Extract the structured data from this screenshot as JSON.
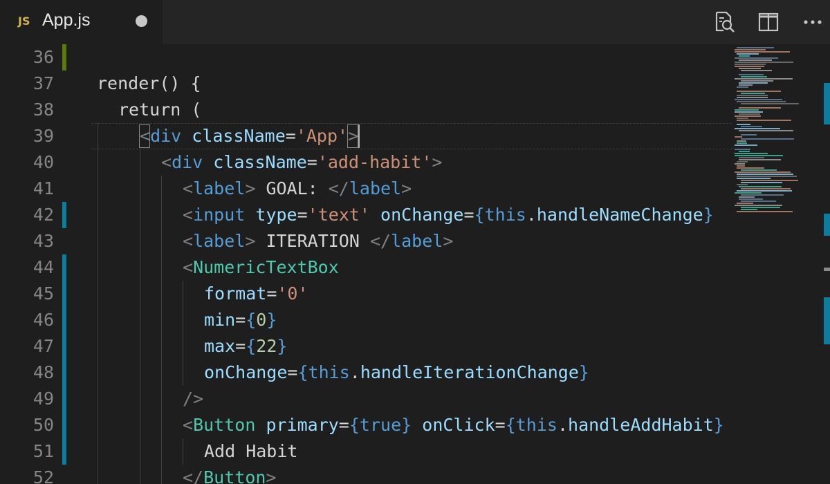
{
  "tab": {
    "lang_badge": "JS",
    "title": "App.js",
    "dirty": true
  },
  "actions": [
    {
      "name": "open-changes-icon"
    },
    {
      "name": "split-editor-icon"
    },
    {
      "name": "more-actions-icon"
    }
  ],
  "lines": [
    {
      "num": "36",
      "indent": 0,
      "gutter": "added",
      "tokens": []
    },
    {
      "num": "37",
      "indent": 0,
      "tokens": [
        {
          "t": "render",
          "c": "t-text"
        },
        {
          "t": "() {",
          "c": "t-text"
        }
      ]
    },
    {
      "num": "38",
      "indent": 1,
      "tokens": [
        {
          "t": "return (",
          "c": "t-text"
        }
      ]
    },
    {
      "num": "39",
      "indent": 2,
      "cursor": true,
      "tokens": [
        {
          "t": "<",
          "c": "t-punc"
        },
        {
          "t": "div",
          "c": "t-tag"
        },
        {
          "t": " ",
          "c": "t-text"
        },
        {
          "t": "className",
          "c": "t-attr"
        },
        {
          "t": "=",
          "c": "t-text"
        },
        {
          "t": "'App'",
          "c": "t-str"
        },
        {
          "t": ">",
          "c": "t-punc"
        }
      ]
    },
    {
      "num": "40",
      "indent": 3,
      "tokens": [
        {
          "t": "<",
          "c": "t-punc"
        },
        {
          "t": "div",
          "c": "t-tag"
        },
        {
          "t": " ",
          "c": "t-text"
        },
        {
          "t": "className",
          "c": "t-attr"
        },
        {
          "t": "=",
          "c": "t-text"
        },
        {
          "t": "'add-habit'",
          "c": "t-str"
        },
        {
          "t": ">",
          "c": "t-punc"
        }
      ]
    },
    {
      "num": "41",
      "indent": 4,
      "tokens": [
        {
          "t": "<",
          "c": "t-punc"
        },
        {
          "t": "label",
          "c": "t-tag"
        },
        {
          "t": ">",
          "c": "t-punc"
        },
        {
          "t": " GOAL: ",
          "c": "t-text"
        },
        {
          "t": "</",
          "c": "t-punc"
        },
        {
          "t": "label",
          "c": "t-tag"
        },
        {
          "t": ">",
          "c": "t-punc"
        }
      ]
    },
    {
      "num": "42",
      "indent": 4,
      "gutter": "modified",
      "tokens": [
        {
          "t": "<",
          "c": "t-punc"
        },
        {
          "t": "input",
          "c": "t-tag"
        },
        {
          "t": " ",
          "c": "t-text"
        },
        {
          "t": "type",
          "c": "t-attr"
        },
        {
          "t": "=",
          "c": "t-text"
        },
        {
          "t": "'text'",
          "c": "t-str"
        },
        {
          "t": " ",
          "c": "t-text"
        },
        {
          "t": "onChange",
          "c": "t-attr"
        },
        {
          "t": "=",
          "c": "t-text"
        },
        {
          "t": "{",
          "c": "t-brace"
        },
        {
          "t": "this",
          "c": "t-kw"
        },
        {
          "t": ".",
          "c": "t-text"
        },
        {
          "t": "handleNameChange",
          "c": "t-attr"
        },
        {
          "t": "}",
          "c": "t-brace"
        }
      ]
    },
    {
      "num": "43",
      "indent": 4,
      "tokens": [
        {
          "t": "<",
          "c": "t-punc"
        },
        {
          "t": "label",
          "c": "t-tag"
        },
        {
          "t": ">",
          "c": "t-punc"
        },
        {
          "t": " ITERATION ",
          "c": "t-text"
        },
        {
          "t": "</",
          "c": "t-punc"
        },
        {
          "t": "label",
          "c": "t-tag"
        },
        {
          "t": ">",
          "c": "t-punc"
        }
      ]
    },
    {
      "num": "44",
      "indent": 4,
      "gutter": "modified",
      "tokens": [
        {
          "t": "<",
          "c": "t-punc"
        },
        {
          "t": "NumericTextBox",
          "c": "t-comp"
        }
      ]
    },
    {
      "num": "45",
      "indent": 5,
      "gutter": "modified",
      "tokens": [
        {
          "t": "format",
          "c": "t-attr"
        },
        {
          "t": "=",
          "c": "t-text"
        },
        {
          "t": "'0'",
          "c": "t-str"
        }
      ]
    },
    {
      "num": "46",
      "indent": 5,
      "gutter": "modified",
      "tokens": [
        {
          "t": "min",
          "c": "t-attr"
        },
        {
          "t": "=",
          "c": "t-text"
        },
        {
          "t": "{",
          "c": "t-brace"
        },
        {
          "t": "0",
          "c": "t-num"
        },
        {
          "t": "}",
          "c": "t-brace"
        }
      ]
    },
    {
      "num": "47",
      "indent": 5,
      "gutter": "modified",
      "tokens": [
        {
          "t": "max",
          "c": "t-attr"
        },
        {
          "t": "=",
          "c": "t-text"
        },
        {
          "t": "{",
          "c": "t-brace"
        },
        {
          "t": "22",
          "c": "t-num"
        },
        {
          "t": "}",
          "c": "t-brace"
        }
      ]
    },
    {
      "num": "48",
      "indent": 5,
      "gutter": "modified",
      "tokens": [
        {
          "t": "onChange",
          "c": "t-attr"
        },
        {
          "t": "=",
          "c": "t-text"
        },
        {
          "t": "{",
          "c": "t-brace"
        },
        {
          "t": "this",
          "c": "t-kw"
        },
        {
          "t": ".",
          "c": "t-text"
        },
        {
          "t": "handleIterationChange",
          "c": "t-attr"
        },
        {
          "t": "}",
          "c": "t-brace"
        }
      ]
    },
    {
      "num": "49",
      "indent": 4,
      "gutter": "modified",
      "tokens": [
        {
          "t": "/>",
          "c": "t-punc"
        }
      ]
    },
    {
      "num": "50",
      "indent": 4,
      "gutter": "modified",
      "tokens": [
        {
          "t": "<",
          "c": "t-punc"
        },
        {
          "t": "Button",
          "c": "t-comp"
        },
        {
          "t": " ",
          "c": "t-text"
        },
        {
          "t": "primary",
          "c": "t-attr"
        },
        {
          "t": "=",
          "c": "t-text"
        },
        {
          "t": "{",
          "c": "t-brace"
        },
        {
          "t": "true",
          "c": "t-kw"
        },
        {
          "t": "}",
          "c": "t-brace"
        },
        {
          "t": " ",
          "c": "t-text"
        },
        {
          "t": "onClick",
          "c": "t-attr"
        },
        {
          "t": "=",
          "c": "t-text"
        },
        {
          "t": "{",
          "c": "t-brace"
        },
        {
          "t": "this",
          "c": "t-kw"
        },
        {
          "t": ".",
          "c": "t-text"
        },
        {
          "t": "handleAddHabit",
          "c": "t-attr"
        },
        {
          "t": "}",
          "c": "t-brace"
        }
      ]
    },
    {
      "num": "51",
      "indent": 5,
      "gutter": "modified",
      "tokens": [
        {
          "t": "Add Habit",
          "c": "t-text"
        }
      ]
    },
    {
      "num": "52",
      "indent": 4,
      "tokens": [
        {
          "t": "</",
          "c": "t-punc"
        },
        {
          "t": "Button",
          "c": "t-comp"
        },
        {
          "t": ">",
          "c": "t-punc"
        }
      ]
    }
  ],
  "colors": {
    "gutter_added": "#587c0c",
    "gutter_modified": "#0c7d9d"
  }
}
